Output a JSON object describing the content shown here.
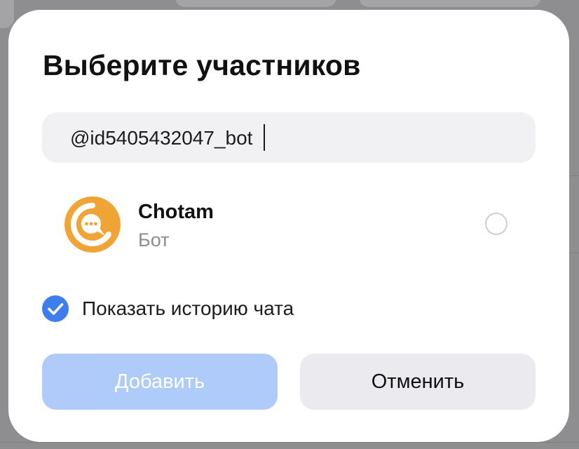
{
  "dialog": {
    "title": "Выберите участников",
    "search": {
      "value": "@id5405432047_bot"
    },
    "participants": [
      {
        "name": "Chotam",
        "subtitle": "Бот",
        "avatar_icon": "chat-bubble-c-icon",
        "avatar_color": "#f0a436",
        "selected": false
      }
    ],
    "show_history": {
      "label": "Показать историю чата",
      "checked": true,
      "color": "#3d7ded"
    },
    "buttons": {
      "add_label": "Добавить",
      "add_disabled": true,
      "cancel_label": "Отменить"
    }
  }
}
